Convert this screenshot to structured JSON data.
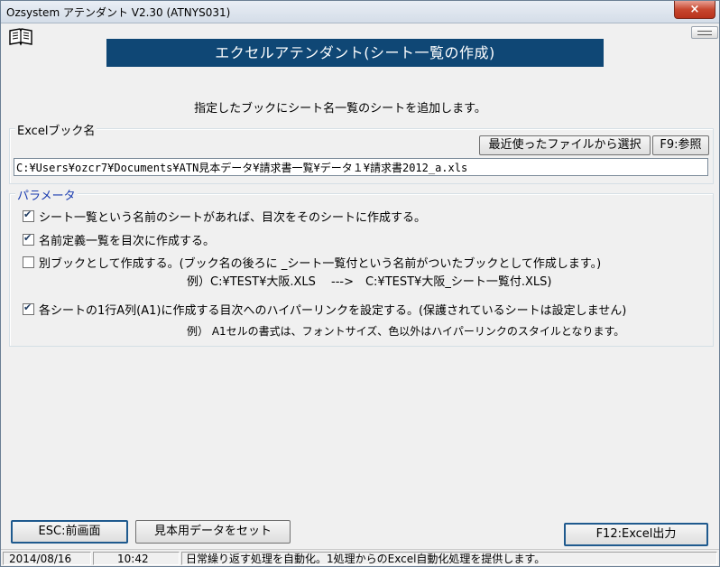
{
  "window": {
    "title": "Ozsystem アテンダント V2.30 (ATNYS031)",
    "close_glyph": "×"
  },
  "icons": {
    "manual": "book-icon",
    "mini": "minimize-bar-icon"
  },
  "banner": {
    "title": "エクセルアテンダント(シート一覧の作成)"
  },
  "description": "指定したブックにシート名一覧のシートを追加します。",
  "excel_group": {
    "legend": "Excelブック名",
    "recent_button": "最近使ったファイルから選択",
    "browse_button": "F9:参照",
    "path": "C:¥Users¥ozcr7¥Documents¥ATN見本データ¥請求書一覧¥データ１¥請求書2012_a.xls"
  },
  "param_group": {
    "legend": "パラメータ",
    "options": [
      {
        "label": "シート一覧という名前のシートがあれば、目次をそのシートに作成する。",
        "checked": true
      },
      {
        "label": "名前定義一覧を目次に作成する。",
        "checked": true
      },
      {
        "label": "別ブックとして作成する。(ブック名の後ろに _シート一覧付という名前がついたブックとして作成します。)",
        "checked": false
      },
      {
        "label": "各シートの1行A列(A1)に作成する目次へのハイパーリンクを設定する。(保護されているシートは設定しません)",
        "checked": true
      }
    ],
    "example1": "例）C:¥TEST¥大阪.XLS　 --->　C:¥TEST¥大阪_シート一覧付.XLS)",
    "example2": "例） A1セルの書式は、フォントサイズ、色以外はハイパーリンクのスタイルとなります。"
  },
  "buttons": {
    "esc": "ESC:前画面",
    "sample": "見本用データをセット",
    "execute": "F12:Excel出力"
  },
  "status": {
    "date": "2014/08/16",
    "time": "10:42",
    "message": "日常繰り返す処理を自動化。1処理からのExcel自動化処理を提供します。"
  },
  "colors": {
    "banner_bg": "#0f4775",
    "accent_border": "#1f5a8e",
    "legend_param": "#1a3cb0"
  }
}
